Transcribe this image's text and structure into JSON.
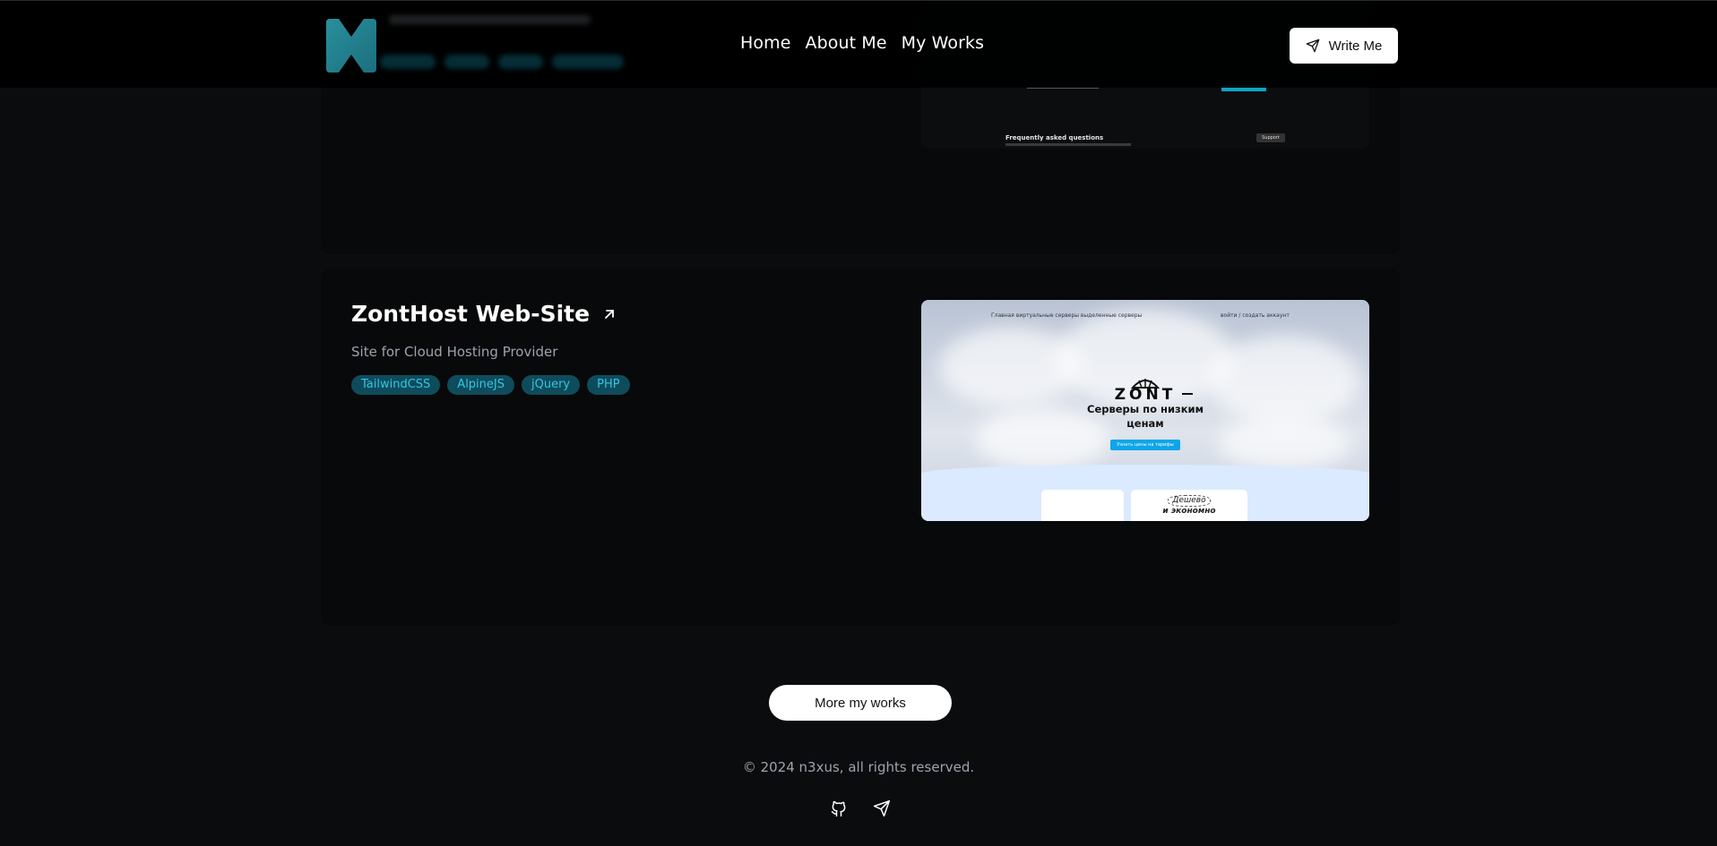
{
  "header": {
    "nav": [
      {
        "label": "Home"
      },
      {
        "label": "About Me"
      },
      {
        "label": "My Works"
      }
    ],
    "write_label": "Write Me"
  },
  "top_card": {
    "preview": {
      "faq": "Frequently asked questions",
      "support": "Support"
    }
  },
  "work": {
    "title": "ZontHost Web-Site",
    "subtitle": "Site for Cloud Hosting Provider",
    "tags": [
      {
        "label": "TailwindCSS"
      },
      {
        "label": "AlpineJS"
      },
      {
        "label": "jQuery"
      },
      {
        "label": "PHP"
      }
    ],
    "preview": {
      "nav_left": "Главная   виртуальные серверы   выделенные серверы",
      "nav_right": "войти / создать аккаунт",
      "brand": "ZONT",
      "headline_1": "Серверы по низким",
      "headline_2": "ценам",
      "cta": "Узнать цены на тарифы",
      "cheap_1": "Дешево",
      "cheap_2": "и экономно"
    }
  },
  "more_label": "More my works",
  "footer": {
    "copyright": "© 2024 n3xus, all rights reserved."
  },
  "colors": {
    "background": "#0b0c0e",
    "card": "#08090a",
    "tag_bg": "#0e4c5c",
    "tag_text": "#35c5e3",
    "muted": "#9ca3af",
    "accent": "#0ea5c6"
  }
}
